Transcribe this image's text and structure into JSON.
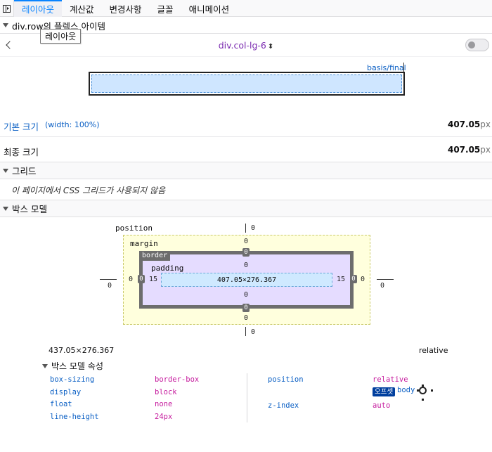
{
  "tabs": [
    {
      "label": "레이아웃",
      "selected": true
    },
    {
      "label": "계산값"
    },
    {
      "label": "변경사항"
    },
    {
      "label": "글꼴"
    },
    {
      "label": "애니메이션"
    }
  ],
  "flex": {
    "header": "div.row의 플렉스 아이템",
    "tooltip": "레이아웃",
    "selector": "div.col-lg-6",
    "selector_arrows": "⬍",
    "basis_label": "basis/final",
    "base_size": {
      "label": "기본 크기",
      "note": "(width: 100%)",
      "value": "407.05",
      "unit": "px"
    },
    "final_size": {
      "label": "최종 크기",
      "value": "407.05",
      "unit": "px"
    }
  },
  "grid": {
    "header": "그리드",
    "message": "이 페이지에서 CSS 그리드가 사용되지 않음"
  },
  "box_model": {
    "header": "박스 모델",
    "position_label": "position",
    "margin_label": "margin",
    "border_label": "border",
    "padding_label": "padding",
    "content": "407.05×276.367",
    "position": {
      "top": "0",
      "right": "0",
      "bottom": "0",
      "left": "0"
    },
    "margin": {
      "top": "0",
      "right": "0",
      "bottom": "0",
      "left": "0"
    },
    "border": {
      "top": "0",
      "right": "0",
      "bottom": "0",
      "left": "0"
    },
    "padding": {
      "top": "0",
      "right": "15",
      "bottom": "0",
      "left": "15"
    },
    "dimensions": "437.05×276.367",
    "position_value": "relative"
  },
  "props": {
    "title": "박스 모델 속성",
    "left": [
      {
        "name": "box-sizing",
        "value": "border-box"
      },
      {
        "name": "display",
        "value": "block"
      },
      {
        "name": "float",
        "value": "none"
      },
      {
        "name": "line-height",
        "value": "24px"
      }
    ],
    "right": [
      {
        "name": "position",
        "value": "relative"
      },
      {
        "name": "z-index",
        "value": "auto"
      }
    ],
    "offset_badge": "오프셋",
    "offset_parent": "body"
  }
}
